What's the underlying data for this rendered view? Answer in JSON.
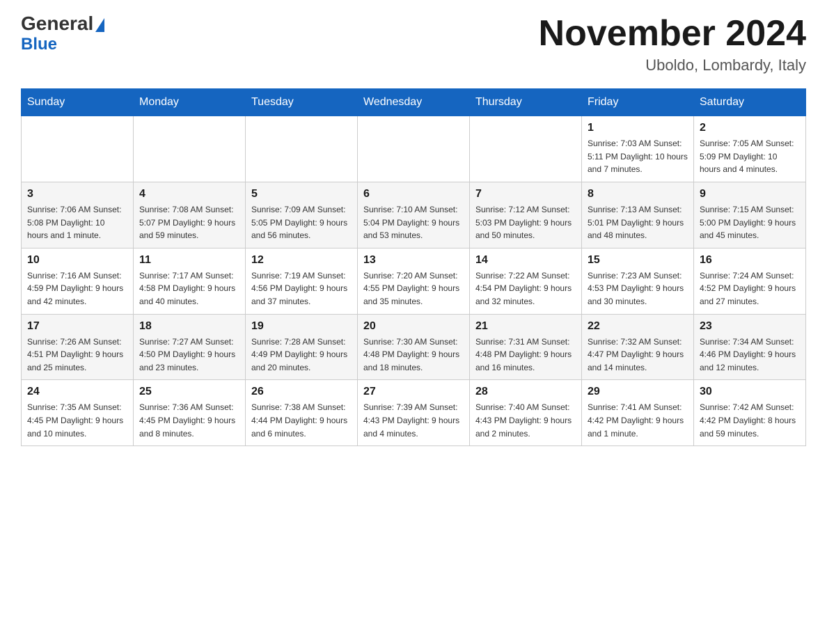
{
  "header": {
    "logo_general": "General",
    "logo_blue": "Blue",
    "month_title": "November 2024",
    "location": "Uboldo, Lombardy, Italy"
  },
  "days_of_week": [
    "Sunday",
    "Monday",
    "Tuesday",
    "Wednesday",
    "Thursday",
    "Friday",
    "Saturday"
  ],
  "weeks": [
    [
      {
        "day": "",
        "info": ""
      },
      {
        "day": "",
        "info": ""
      },
      {
        "day": "",
        "info": ""
      },
      {
        "day": "",
        "info": ""
      },
      {
        "day": "",
        "info": ""
      },
      {
        "day": "1",
        "info": "Sunrise: 7:03 AM\nSunset: 5:11 PM\nDaylight: 10 hours and 7 minutes."
      },
      {
        "day": "2",
        "info": "Sunrise: 7:05 AM\nSunset: 5:09 PM\nDaylight: 10 hours and 4 minutes."
      }
    ],
    [
      {
        "day": "3",
        "info": "Sunrise: 7:06 AM\nSunset: 5:08 PM\nDaylight: 10 hours and 1 minute."
      },
      {
        "day": "4",
        "info": "Sunrise: 7:08 AM\nSunset: 5:07 PM\nDaylight: 9 hours and 59 minutes."
      },
      {
        "day": "5",
        "info": "Sunrise: 7:09 AM\nSunset: 5:05 PM\nDaylight: 9 hours and 56 minutes."
      },
      {
        "day": "6",
        "info": "Sunrise: 7:10 AM\nSunset: 5:04 PM\nDaylight: 9 hours and 53 minutes."
      },
      {
        "day": "7",
        "info": "Sunrise: 7:12 AM\nSunset: 5:03 PM\nDaylight: 9 hours and 50 minutes."
      },
      {
        "day": "8",
        "info": "Sunrise: 7:13 AM\nSunset: 5:01 PM\nDaylight: 9 hours and 48 minutes."
      },
      {
        "day": "9",
        "info": "Sunrise: 7:15 AM\nSunset: 5:00 PM\nDaylight: 9 hours and 45 minutes."
      }
    ],
    [
      {
        "day": "10",
        "info": "Sunrise: 7:16 AM\nSunset: 4:59 PM\nDaylight: 9 hours and 42 minutes."
      },
      {
        "day": "11",
        "info": "Sunrise: 7:17 AM\nSunset: 4:58 PM\nDaylight: 9 hours and 40 minutes."
      },
      {
        "day": "12",
        "info": "Sunrise: 7:19 AM\nSunset: 4:56 PM\nDaylight: 9 hours and 37 minutes."
      },
      {
        "day": "13",
        "info": "Sunrise: 7:20 AM\nSunset: 4:55 PM\nDaylight: 9 hours and 35 minutes."
      },
      {
        "day": "14",
        "info": "Sunrise: 7:22 AM\nSunset: 4:54 PM\nDaylight: 9 hours and 32 minutes."
      },
      {
        "day": "15",
        "info": "Sunrise: 7:23 AM\nSunset: 4:53 PM\nDaylight: 9 hours and 30 minutes."
      },
      {
        "day": "16",
        "info": "Sunrise: 7:24 AM\nSunset: 4:52 PM\nDaylight: 9 hours and 27 minutes."
      }
    ],
    [
      {
        "day": "17",
        "info": "Sunrise: 7:26 AM\nSunset: 4:51 PM\nDaylight: 9 hours and 25 minutes."
      },
      {
        "day": "18",
        "info": "Sunrise: 7:27 AM\nSunset: 4:50 PM\nDaylight: 9 hours and 23 minutes."
      },
      {
        "day": "19",
        "info": "Sunrise: 7:28 AM\nSunset: 4:49 PM\nDaylight: 9 hours and 20 minutes."
      },
      {
        "day": "20",
        "info": "Sunrise: 7:30 AM\nSunset: 4:48 PM\nDaylight: 9 hours and 18 minutes."
      },
      {
        "day": "21",
        "info": "Sunrise: 7:31 AM\nSunset: 4:48 PM\nDaylight: 9 hours and 16 minutes."
      },
      {
        "day": "22",
        "info": "Sunrise: 7:32 AM\nSunset: 4:47 PM\nDaylight: 9 hours and 14 minutes."
      },
      {
        "day": "23",
        "info": "Sunrise: 7:34 AM\nSunset: 4:46 PM\nDaylight: 9 hours and 12 minutes."
      }
    ],
    [
      {
        "day": "24",
        "info": "Sunrise: 7:35 AM\nSunset: 4:45 PM\nDaylight: 9 hours and 10 minutes."
      },
      {
        "day": "25",
        "info": "Sunrise: 7:36 AM\nSunset: 4:45 PM\nDaylight: 9 hours and 8 minutes."
      },
      {
        "day": "26",
        "info": "Sunrise: 7:38 AM\nSunset: 4:44 PM\nDaylight: 9 hours and 6 minutes."
      },
      {
        "day": "27",
        "info": "Sunrise: 7:39 AM\nSunset: 4:43 PM\nDaylight: 9 hours and 4 minutes."
      },
      {
        "day": "28",
        "info": "Sunrise: 7:40 AM\nSunset: 4:43 PM\nDaylight: 9 hours and 2 minutes."
      },
      {
        "day": "29",
        "info": "Sunrise: 7:41 AM\nSunset: 4:42 PM\nDaylight: 9 hours and 1 minute."
      },
      {
        "day": "30",
        "info": "Sunrise: 7:42 AM\nSunset: 4:42 PM\nDaylight: 8 hours and 59 minutes."
      }
    ]
  ]
}
